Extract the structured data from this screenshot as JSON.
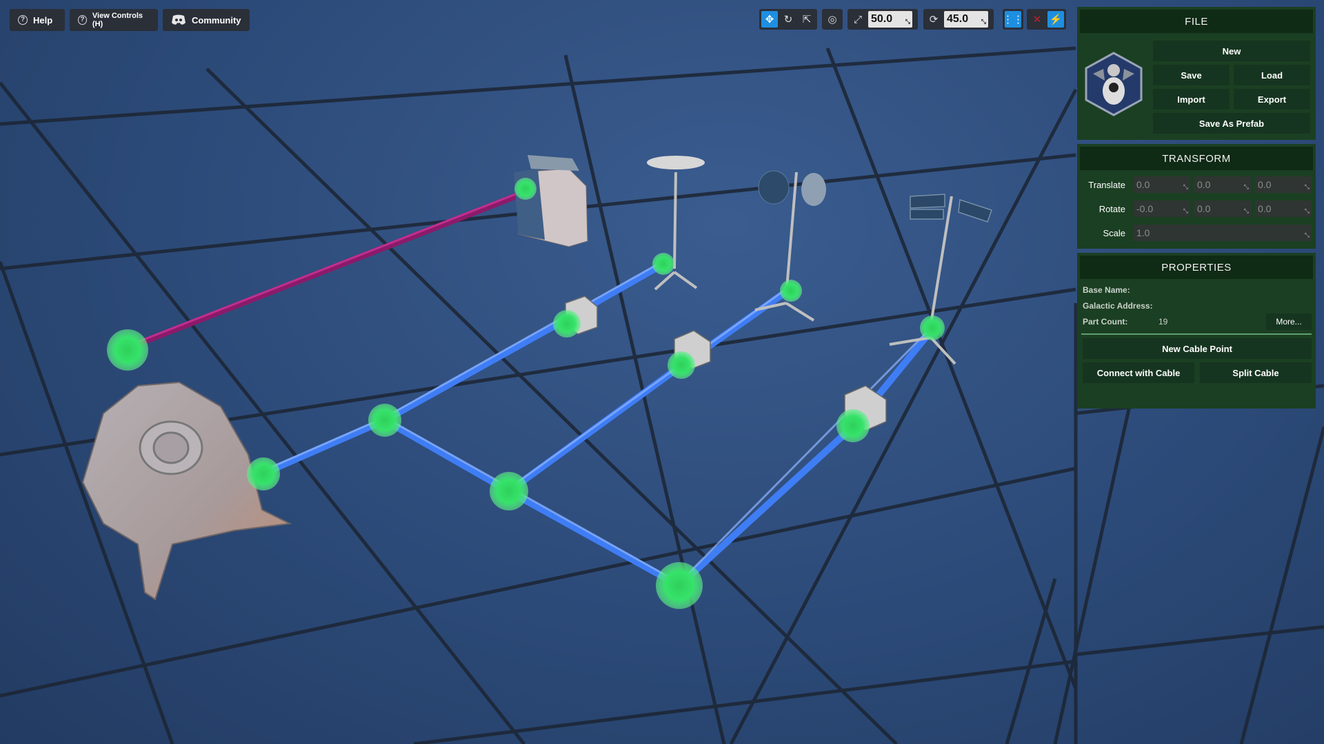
{
  "top_left": {
    "help_label": "Help",
    "view_controls_label": "View Controls (H)",
    "community_label": "Community"
  },
  "toolbar": {
    "move_value": "50.0",
    "rotate_value": "45.0",
    "icons": [
      "move-icon",
      "rotate-icon",
      "external-icon",
      "globe-icon",
      "scale-icon",
      "rotate-snap-icon",
      "grid-icon",
      "debug-icon",
      "power-icon"
    ]
  },
  "file_panel": {
    "title": "FILE",
    "new_label": "New",
    "save_label": "Save",
    "load_label": "Load",
    "import_label": "Import",
    "export_label": "Export",
    "save_as_prefab_label": "Save As Prefab"
  },
  "transform_panel": {
    "title": "TRANSFORM",
    "translate_label": "Translate",
    "rotate_label": "Rotate",
    "scale_label": "Scale",
    "translate": [
      "0.0",
      "0.0",
      "0.0"
    ],
    "rotate": [
      "-0.0",
      "0.0",
      "0.0"
    ],
    "scale": "1.0"
  },
  "properties_panel": {
    "title": "PROPERTIES",
    "base_name_label": "Base Name:",
    "galactic_address_label": "Galactic Address:",
    "part_count_label": "Part Count:",
    "part_count_value": "19",
    "more_label": "More...",
    "new_cable_point_label": "New Cable Point",
    "connect_with_cable_label": "Connect with Cable",
    "split_cable_label": "Split Cable"
  },
  "colors": {
    "background": "#2c4a78",
    "panel_green": "#1b3f22",
    "panel_header": "#0f2a15",
    "cable_blue": "#3f7df5",
    "cable_magenta": "#8c1a6a",
    "node_green": "#33e36a",
    "toolbar_active": "#1e8fe0"
  }
}
